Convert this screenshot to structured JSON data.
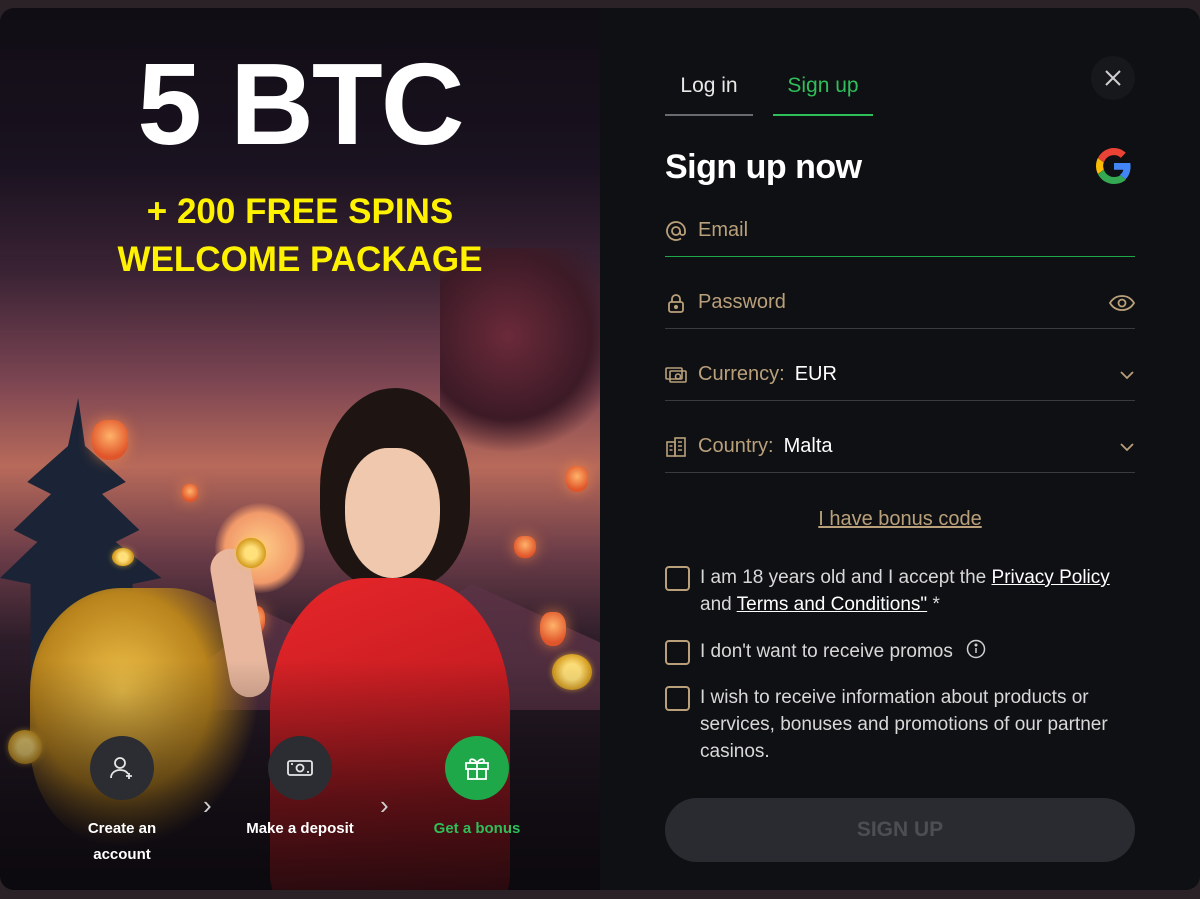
{
  "promo": {
    "headline": "5 BTC",
    "sub_line1": "+ 200 FREE SPINS",
    "sub_line2": "WELCOME PACKAGE",
    "steps": [
      {
        "label": "Create an account",
        "icon": "user-add-icon",
        "active": false
      },
      {
        "label": "Make a deposit",
        "icon": "cash-icon",
        "active": false
      },
      {
        "label": "Get a bonus",
        "icon": "gift-icon",
        "active": true
      }
    ]
  },
  "tabs": {
    "login": "Log in",
    "signup": "Sign up",
    "active": "signup"
  },
  "form": {
    "title": "Sign up now",
    "email_placeholder": "Email",
    "password_placeholder": "Password",
    "currency_label": "Currency:",
    "currency_value": "EUR",
    "country_label": "Country:",
    "country_value": "Malta",
    "bonus_link": "I have bonus code",
    "age_text_start": "I am 18 years old and I accept the",
    "privacy_link": "Privacy Policy",
    "and_text": "and",
    "terms_link": "Terms and Conditions\"",
    "required_mark": "*",
    "no_promos_text": "I don't want to receive promos",
    "partner_text": "I wish to receive information about products or services, bonuses and promotions of our partner casinos.",
    "submit_label": "SIGN UP"
  },
  "colors": {
    "accent_green": "#2fbf5a",
    "gold_text": "#b9a07b",
    "promo_yellow": "#fff200",
    "panel_bg": "#0f1013"
  }
}
